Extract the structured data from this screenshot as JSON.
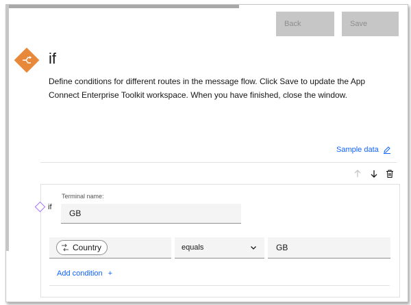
{
  "toolbar": {
    "back_label": "Back",
    "save_label": "Save"
  },
  "node": {
    "title": "if",
    "description": "Define conditions for different routes in the message flow. Click Save to update the App Connect Enterprise Toolkit workspace. When you have finished, close the window."
  },
  "sample_data": {
    "label": "Sample data"
  },
  "route": {
    "if_label": "if",
    "terminal_name_label": "Terminal name:",
    "terminal_name_value": "GB",
    "condition": {
      "field_tag": "Country",
      "operator": "equals",
      "value": "GB"
    },
    "add_condition_label": "Add condition",
    "add_condition_symbol": "+"
  },
  "colors": {
    "accent": "#0f62fe",
    "icon_orange": "#e8883a",
    "diamond_purple": "#a56eff",
    "disabled_button": "#c6c6c6"
  },
  "icons": [
    "if-node-icon",
    "edit-icon",
    "arrow-up-icon",
    "arrow-down-icon",
    "trash-icon",
    "route-diamond-icon",
    "field-mapping-icon",
    "chevron-down-icon",
    "plus-icon"
  ]
}
